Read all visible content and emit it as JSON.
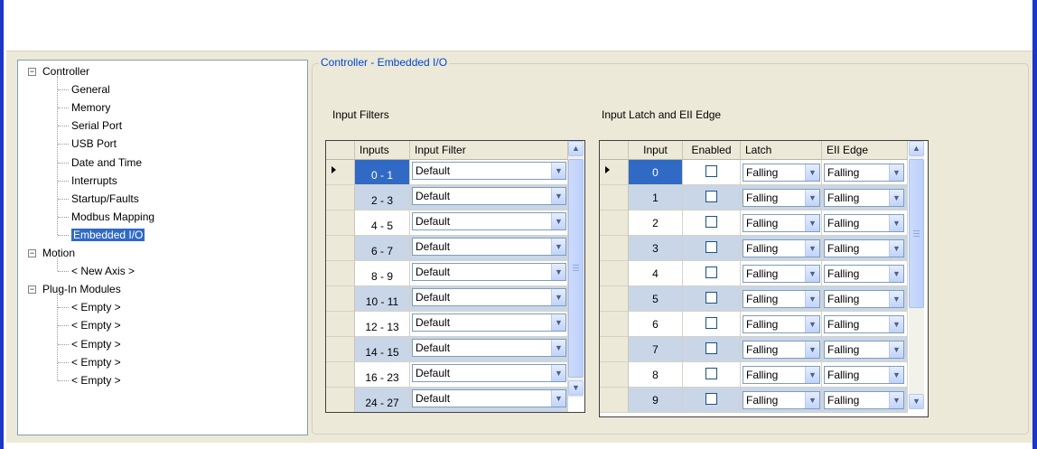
{
  "tree": {
    "items": [
      {
        "label": "Controller",
        "level": 0,
        "expander": "minus"
      },
      {
        "label": "General",
        "level": 1
      },
      {
        "label": "Memory",
        "level": 1
      },
      {
        "label": "Serial Port",
        "level": 1
      },
      {
        "label": "USB Port",
        "level": 1
      },
      {
        "label": "Date and Time",
        "level": 1
      },
      {
        "label": "Interrupts",
        "level": 1
      },
      {
        "label": "Startup/Faults",
        "level": 1
      },
      {
        "label": "Modbus Mapping",
        "level": 1
      },
      {
        "label": "Embedded I/O",
        "level": 1,
        "selected": true
      },
      {
        "label": "Motion",
        "level": 0,
        "expander": "minus"
      },
      {
        "label": "< New Axis >",
        "level": 1
      },
      {
        "label": "Plug-In Modules",
        "level": 0,
        "expander": "minus"
      },
      {
        "label": "< Empty >",
        "level": 1
      },
      {
        "label": "< Empty >",
        "level": 1
      },
      {
        "label": "< Empty >",
        "level": 1
      },
      {
        "label": "< Empty >",
        "level": 1
      },
      {
        "label": "< Empty >",
        "level": 1
      }
    ]
  },
  "group_title": "Controller - Embedded I/O",
  "input_filters": {
    "label": "Input Filters",
    "columns": [
      "Inputs",
      "Input Filter"
    ],
    "rows": [
      {
        "inputs": "0 - 1",
        "filter": "Default"
      },
      {
        "inputs": "2 - 3",
        "filter": "Default"
      },
      {
        "inputs": "4 - 5",
        "filter": "Default"
      },
      {
        "inputs": "6 - 7",
        "filter": "Default"
      },
      {
        "inputs": "8 - 9",
        "filter": "Default"
      },
      {
        "inputs": "10 - 11",
        "filter": "Default"
      },
      {
        "inputs": "12 - 13",
        "filter": "Default"
      },
      {
        "inputs": "14 - 15",
        "filter": "Default"
      },
      {
        "inputs": "16 - 23",
        "filter": "Default"
      },
      {
        "inputs": "24 - 27",
        "filter": "Default"
      }
    ]
  },
  "input_latch": {
    "label": "Input Latch and EII Edge",
    "columns": [
      "Input",
      "Enabled",
      "Latch",
      "EII Edge"
    ],
    "rows": [
      {
        "input": "0",
        "enabled": false,
        "latch": "Falling",
        "edge": "Falling"
      },
      {
        "input": "1",
        "enabled": false,
        "latch": "Falling",
        "edge": "Falling"
      },
      {
        "input": "2",
        "enabled": false,
        "latch": "Falling",
        "edge": "Falling"
      },
      {
        "input": "3",
        "enabled": false,
        "latch": "Falling",
        "edge": "Falling"
      },
      {
        "input": "4",
        "enabled": false,
        "latch": "Falling",
        "edge": "Falling"
      },
      {
        "input": "5",
        "enabled": false,
        "latch": "Falling",
        "edge": "Falling"
      },
      {
        "input": "6",
        "enabled": false,
        "latch": "Falling",
        "edge": "Falling"
      },
      {
        "input": "7",
        "enabled": false,
        "latch": "Falling",
        "edge": "Falling"
      },
      {
        "input": "8",
        "enabled": false,
        "latch": "Falling",
        "edge": "Falling"
      },
      {
        "input": "9",
        "enabled": false,
        "latch": "Falling",
        "edge": "Falling"
      }
    ]
  },
  "colors": {
    "accent_blue": "#316ac5",
    "title_blue": "#0046d5",
    "alt_row": "#c9d6e8",
    "window_bg": "#ece9d8",
    "border_blue": "#1c36c8"
  },
  "icons": {
    "expander": "minus-box-icon",
    "dropdown": "chevron-down-icon",
    "scroll_up": "chevron-up-icon",
    "scroll_down": "chevron-down-icon",
    "current_row": "row-pointer-icon"
  }
}
